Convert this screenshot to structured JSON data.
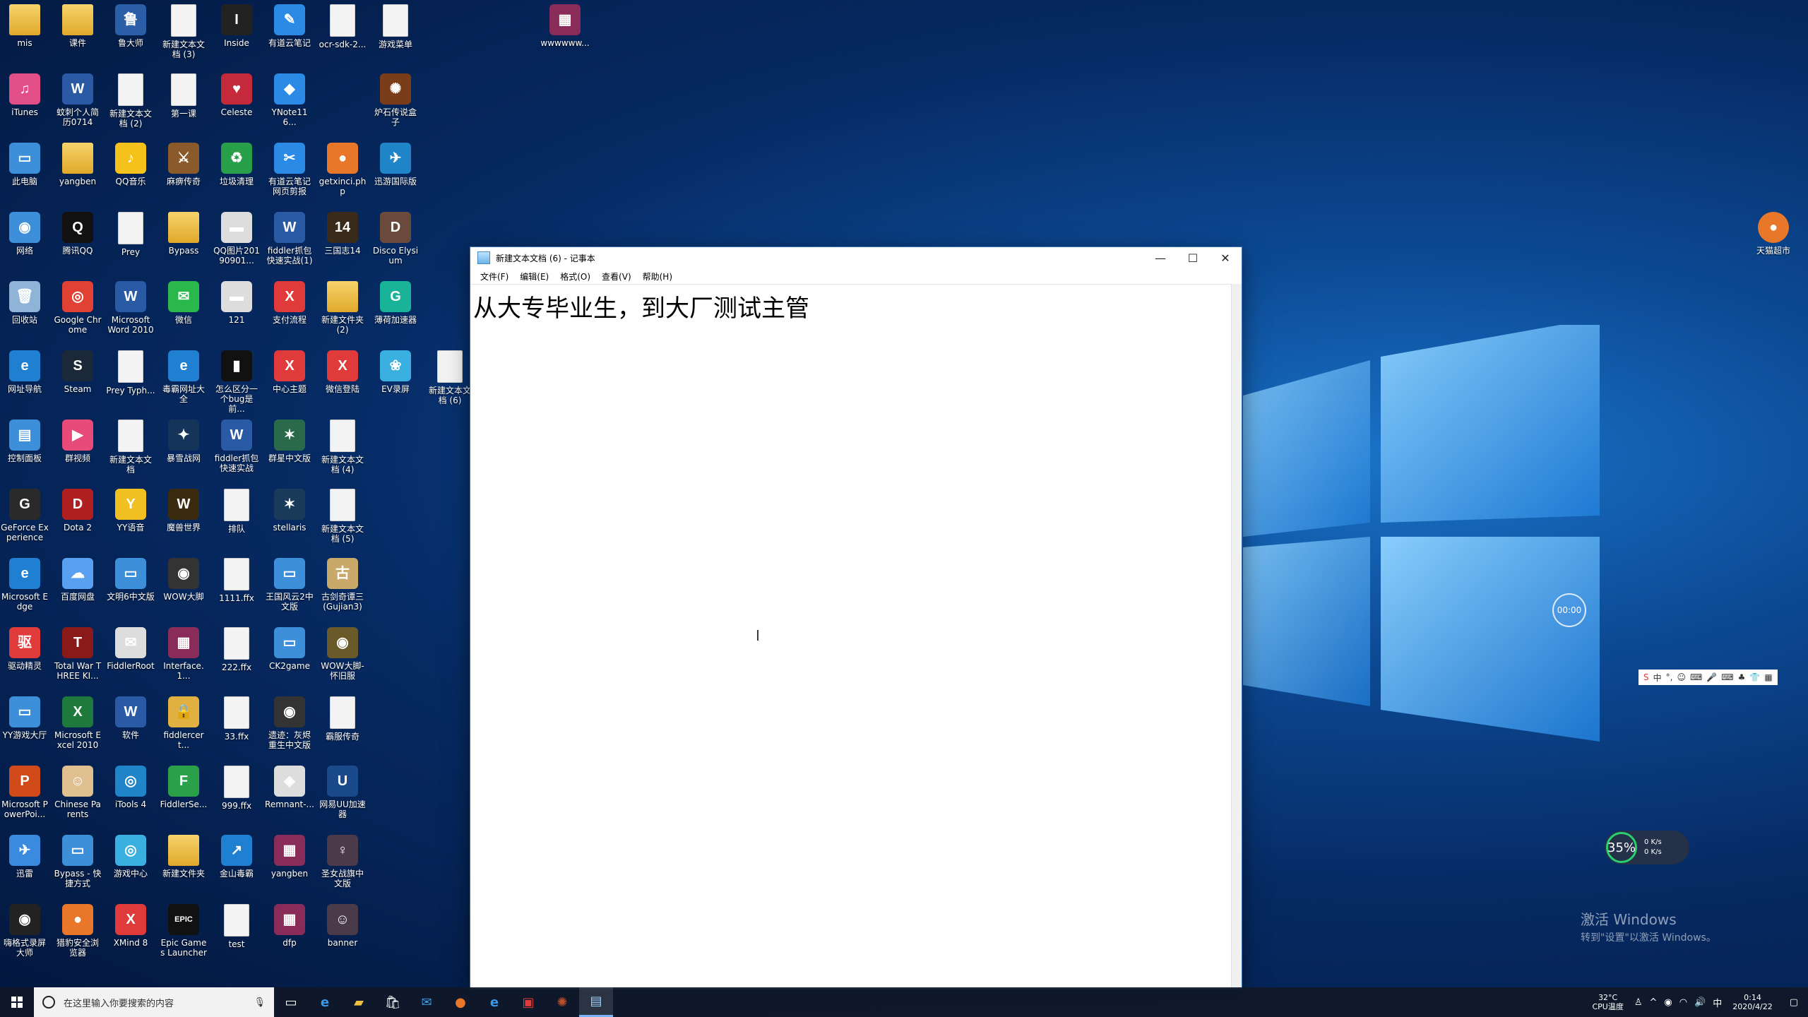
{
  "desktop": {
    "icons": [
      {
        "label": "mis",
        "kind": "folder",
        "color": "#e0b040"
      },
      {
        "label": "课件",
        "kind": "folder",
        "color": "#e0b040"
      },
      {
        "label": "鲁大师",
        "kind": "app",
        "color": "#2a5fa8",
        "glyph": "鲁"
      },
      {
        "label": "新建文本文档 (3)",
        "kind": "doc"
      },
      {
        "label": "Inside",
        "kind": "app",
        "color": "#222222",
        "glyph": "I"
      },
      {
        "label": "有道云笔记",
        "kind": "app",
        "color": "#2b8ae6",
        "glyph": "✎"
      },
      {
        "label": "ocr-sdk-2...",
        "kind": "doc"
      },
      {
        "label": "游戏菜单",
        "kind": "doc"
      },
      {
        "label": "wwwwww...",
        "kind": "app",
        "color": "#8a2c5a",
        "glyph": "▦"
      },
      {
        "label": "iTunes",
        "kind": "app",
        "color": "#e14f86",
        "glyph": "♫"
      },
      {
        "label": "蚊刺个人简历0714",
        "kind": "app",
        "color": "#2b5aa5",
        "glyph": "W"
      },
      {
        "label": "新建文本文档 (2)",
        "kind": "doc"
      },
      {
        "label": "第一课",
        "kind": "doc"
      },
      {
        "label": "Celeste",
        "kind": "app",
        "color": "#c52a3a",
        "glyph": "♥"
      },
      {
        "label": "YNote116...",
        "kind": "app",
        "color": "#2b8ae6",
        "glyph": "◆"
      },
      {
        "label": "炉石传说盒子",
        "kind": "app",
        "color": "#7a3d1a",
        "glyph": "✺"
      },
      {
        "label": "此电脑",
        "kind": "app",
        "color": "#3c8fd8",
        "glyph": "▭"
      },
      {
        "label": "yangben",
        "kind": "folder",
        "color": "#e0b040"
      },
      {
        "label": "QQ音乐",
        "kind": "app",
        "color": "#f4c21a",
        "glyph": "♪"
      },
      {
        "label": "麻痹传奇",
        "kind": "app",
        "color": "#8a5a2a",
        "glyph": "⚔"
      },
      {
        "label": "垃圾清理",
        "kind": "app",
        "color": "#28a04a",
        "glyph": "♻"
      },
      {
        "label": "有道云笔记网页剪报",
        "kind": "app",
        "color": "#2b8ae6",
        "glyph": "✂"
      },
      {
        "label": "getxinci.php",
        "kind": "app",
        "color": "#e8772a",
        "glyph": "●"
      },
      {
        "label": "迅游国际版",
        "kind": "app",
        "color": "#1f84c8",
        "glyph": "✈"
      },
      {
        "label": "网络",
        "kind": "app",
        "color": "#3c8fd8",
        "glyph": "◉"
      },
      {
        "label": "腾讯QQ",
        "kind": "app",
        "color": "#111111",
        "glyph": "Q"
      },
      {
        "label": "Prey",
        "kind": "doc"
      },
      {
        "label": "Bypass",
        "kind": "folder",
        "color": "#e0b040"
      },
      {
        "label": "QQ图片20190901...",
        "kind": "app",
        "color": "#dddddd",
        "glyph": "▬"
      },
      {
        "label": "fiddler抓包快速实战(1)",
        "kind": "app",
        "color": "#2b5aa5",
        "glyph": "W"
      },
      {
        "label": "三国志14",
        "kind": "app",
        "color": "#3a2a1a",
        "glyph": "14"
      },
      {
        "label": "Disco Elysium",
        "kind": "app",
        "color": "#6a4a3a",
        "glyph": "D"
      },
      {
        "label": "回收站",
        "kind": "app",
        "color": "#8fb4d8",
        "glyph": "🗑"
      },
      {
        "label": "Google Chrome",
        "kind": "app",
        "color": "#e14133",
        "glyph": "◎"
      },
      {
        "label": "Microsoft Word 2010",
        "kind": "app",
        "color": "#2b5aa5",
        "glyph": "W"
      },
      {
        "label": "微信",
        "kind": "app",
        "color": "#2ab84c",
        "glyph": "✉"
      },
      {
        "label": "121",
        "kind": "app",
        "color": "#dddddd",
        "glyph": "▬"
      },
      {
        "label": "支付流程",
        "kind": "app",
        "color": "#e03a3a",
        "glyph": "X"
      },
      {
        "label": "新建文件夹 (2)",
        "kind": "folder",
        "color": "#e0b040"
      },
      {
        "label": "薄荷加速器",
        "kind": "app",
        "color": "#19b39a",
        "glyph": "G"
      },
      {
        "label": "网址导航",
        "kind": "app",
        "color": "#1f7fd1",
        "glyph": "e"
      },
      {
        "label": "Steam",
        "kind": "app",
        "color": "#1b2838",
        "glyph": "S"
      },
      {
        "label": "Prey Typh...",
        "kind": "doc"
      },
      {
        "label": "毒霸网址大全",
        "kind": "app",
        "color": "#1f7fd1",
        "glyph": "e"
      },
      {
        "label": "怎么区分一个bug是前...",
        "kind": "app",
        "color": "#111111",
        "glyph": "▮"
      },
      {
        "label": "中心主题",
        "kind": "app",
        "color": "#e03a3a",
        "glyph": "X"
      },
      {
        "label": "微信登陆",
        "kind": "app",
        "color": "#e03a3a",
        "glyph": "X"
      },
      {
        "label": "EV录屏",
        "kind": "app",
        "color": "#3ab0e0",
        "glyph": "❀"
      },
      {
        "label": "新建文本文档 (6)",
        "kind": "doc"
      },
      {
        "label": "控制面板",
        "kind": "app",
        "color": "#3c8fd8",
        "glyph": "▤"
      },
      {
        "label": "群视频",
        "kind": "app",
        "color": "#e84a7a",
        "glyph": "▶"
      },
      {
        "label": "新建文本文档",
        "kind": "doc"
      },
      {
        "label": "暴雪战网",
        "kind": "app",
        "color": "#14345a",
        "glyph": "✦"
      },
      {
        "label": "fiddler抓包快速实战",
        "kind": "app",
        "color": "#2b5aa5",
        "glyph": "W"
      },
      {
        "label": "群星中文版",
        "kind": "app",
        "color": "#2a6a4a",
        "glyph": "✶"
      },
      {
        "label": "新建文本文档 (4)",
        "kind": "doc"
      },
      {
        "label": "GeForce Experience",
        "kind": "app",
        "color": "#2a2a2a",
        "glyph": "G"
      },
      {
        "label": "Dota 2",
        "kind": "app",
        "color": "#b02020",
        "glyph": "D"
      },
      {
        "label": "YY语音",
        "kind": "app",
        "color": "#f0c020",
        "glyph": "Y"
      },
      {
        "label": "魔兽世界",
        "kind": "app",
        "color": "#3a2a10",
        "glyph": "W"
      },
      {
        "label": "排队",
        "kind": "doc"
      },
      {
        "label": "stellaris",
        "kind": "app",
        "color": "#1a3a5a",
        "glyph": "✶"
      },
      {
        "label": "新建文本文档 (5)",
        "kind": "doc"
      },
      {
        "label": "Microsoft Edge",
        "kind": "app",
        "color": "#1f7fd1",
        "glyph": "e"
      },
      {
        "label": "百度网盘",
        "kind": "app",
        "color": "#5aa0f0",
        "glyph": "☁"
      },
      {
        "label": "文明6中文版",
        "kind": "app",
        "color": "#3c8fd8",
        "glyph": "▭"
      },
      {
        "label": "WOW大脚",
        "kind": "app",
        "color": "#333333",
        "glyph": "◉"
      },
      {
        "label": "1111.ffx",
        "kind": "doc"
      },
      {
        "label": "王国风云2中文版",
        "kind": "app",
        "color": "#3c8fd8",
        "glyph": "▭"
      },
      {
        "label": "古剑奇谭三(Gujian3)",
        "kind": "app",
        "color": "#c9a96a",
        "glyph": "古"
      },
      {
        "label": "驱动精灵",
        "kind": "app",
        "color": "#e03a3a",
        "glyph": "驱"
      },
      {
        "label": "Total War THREE KI...",
        "kind": "app",
        "color": "#8a1a1a",
        "glyph": "T"
      },
      {
        "label": "FiddlerRoot",
        "kind": "app",
        "color": "#dddddd",
        "glyph": "✉"
      },
      {
        "label": "Interface.1...",
        "kind": "app",
        "color": "#8a2c5a",
        "glyph": "▦"
      },
      {
        "label": "222.ffx",
        "kind": "doc"
      },
      {
        "label": "CK2game",
        "kind": "app",
        "color": "#3c8fd8",
        "glyph": "▭"
      },
      {
        "label": "WOW大脚-怀旧服",
        "kind": "app",
        "color": "#6a5a2a",
        "glyph": "◉"
      },
      {
        "label": "YY游戏大厅",
        "kind": "app",
        "color": "#3c8fd8",
        "glyph": "▭"
      },
      {
        "label": "Microsoft Excel 2010",
        "kind": "app",
        "color": "#1e7a3c",
        "glyph": "X"
      },
      {
        "label": "软件",
        "kind": "app",
        "color": "#2b5aa5",
        "glyph": "W"
      },
      {
        "label": "fiddlercert...",
        "kind": "app",
        "color": "#e0b040",
        "glyph": "🔒"
      },
      {
        "label": "33.ffx",
        "kind": "doc"
      },
      {
        "label": "遗迹：灰烬重生中文版",
        "kind": "app",
        "color": "#333333",
        "glyph": "◉"
      },
      {
        "label": "霸服传奇",
        "kind": "doc"
      },
      {
        "label": "Microsoft PowerPoi...",
        "kind": "app",
        "color": "#d04a1a",
        "glyph": "P"
      },
      {
        "label": "Chinese Parents",
        "kind": "app",
        "color": "#e0c090",
        "glyph": "☺"
      },
      {
        "label": "iTools 4",
        "kind": "app",
        "color": "#1f84c8",
        "glyph": "◎"
      },
      {
        "label": "FiddlerSe...",
        "kind": "app",
        "color": "#2aa04a",
        "glyph": "F"
      },
      {
        "label": "999.ffx",
        "kind": "doc"
      },
      {
        "label": "Remnant-...",
        "kind": "app",
        "color": "#dddddd",
        "glyph": "◈"
      },
      {
        "label": "网易UU加速器",
        "kind": "app",
        "color": "#1a4a8a",
        "glyph": "U"
      },
      {
        "label": "迅雷",
        "kind": "app",
        "color": "#3a8ae0",
        "glyph": "✈"
      },
      {
        "label": "Bypass - 快捷方式",
        "kind": "app",
        "color": "#3c8fd8",
        "glyph": "▭"
      },
      {
        "label": "游戏中心",
        "kind": "app",
        "color": "#3ab0e0",
        "glyph": "◎"
      },
      {
        "label": "新建文件夹",
        "kind": "folder",
        "color": "#e0b040"
      },
      {
        "label": "金山毒霸",
        "kind": "app",
        "color": "#1f7fd1",
        "glyph": "↗"
      },
      {
        "label": "yangben",
        "kind": "app",
        "color": "#8a2c5a",
        "glyph": "▦"
      },
      {
        "label": "圣女战旗中文版",
        "kind": "app",
        "color": "#4a3a4a",
        "glyph": "♀"
      },
      {
        "label": "嗨格式录屏大师",
        "kind": "app",
        "color": "#222222",
        "glyph": "◉"
      },
      {
        "label": "猎豹安全浏览器",
        "kind": "app",
        "color": "#e8772a",
        "glyph": "●"
      },
      {
        "label": "XMind 8",
        "kind": "app",
        "color": "#e03a3a",
        "glyph": "X"
      },
      {
        "label": "Epic Games Launcher",
        "kind": "app",
        "color": "#111111",
        "glyph": "EPIC"
      },
      {
        "label": "test",
        "kind": "doc"
      },
      {
        "label": "dfp",
        "kind": "app",
        "color": "#8a2c5a",
        "glyph": "▦"
      },
      {
        "label": "banner",
        "kind": "app",
        "color": "#4a3a4a",
        "glyph": "☺"
      }
    ]
  },
  "notepad": {
    "title": "新建文本文档 (6) - 记事本",
    "menu": [
      "文件(F)",
      "编辑(E)",
      "格式(O)",
      "查看(V)",
      "帮助(H)"
    ],
    "content": "从大专毕业生，到大厂测试主管"
  },
  "overlays": {
    "tmall_label": "天猫超市",
    "timer": "00:00",
    "ime": [
      "S",
      "中",
      "°,",
      "☺",
      "⌨",
      "🎤",
      "⌨",
      "♣",
      "👕",
      "▦"
    ],
    "netmon": {
      "percent": "35%",
      "up": "0 K/s",
      "down": "0 K/s"
    },
    "activate_title": "激活 Windows",
    "activate_sub": "转到\"设置\"以激活 Windows。"
  },
  "taskbar": {
    "search_placeholder": "在这里输入你要搜索的内容",
    "temp": "32°C",
    "temp_label": "CPU温度",
    "time": "0:14",
    "date": "2020/4/22",
    "ime_lang": "中"
  },
  "colors": {
    "taskbar_bg": "#101828",
    "notepad_border": "#3a6fb0"
  }
}
